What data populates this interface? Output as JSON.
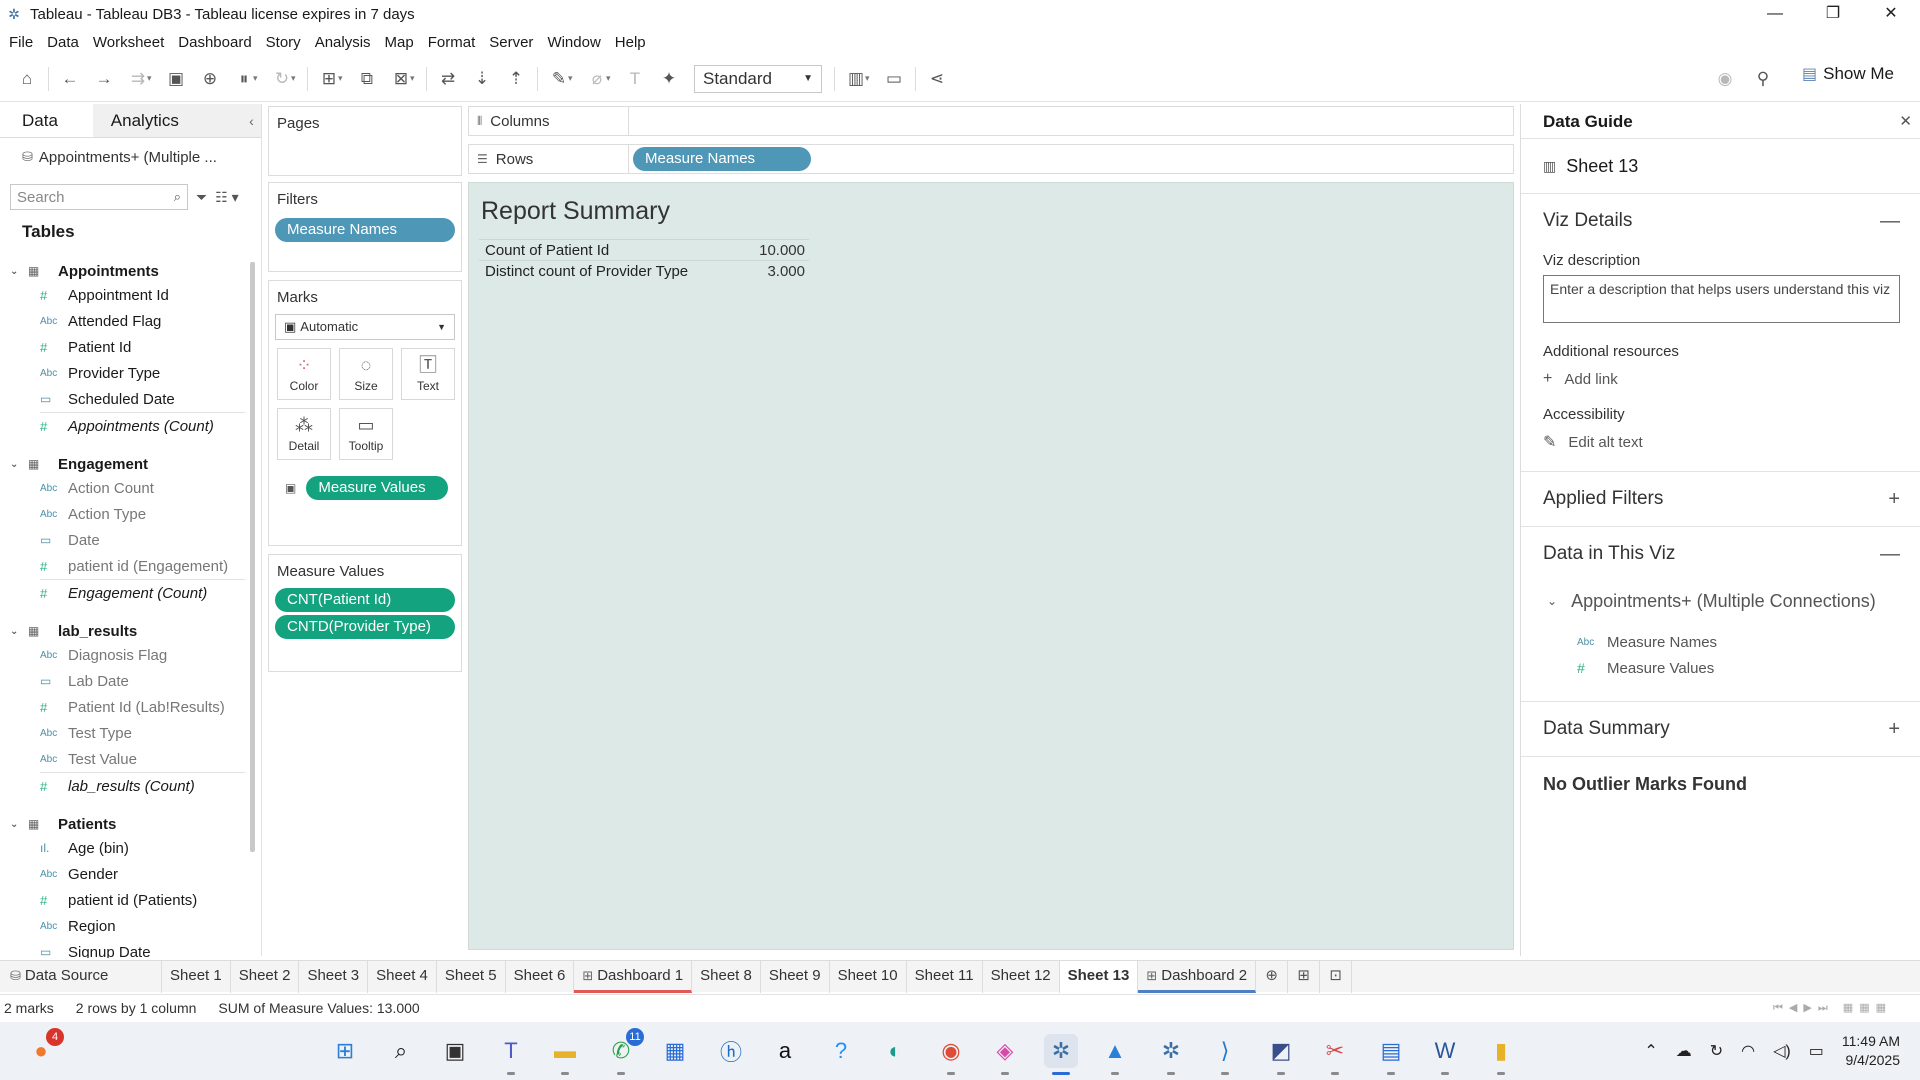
{
  "window": {
    "title": "Tableau - Tableau DB3 - Tableau license expires in 7 days",
    "controls": [
      "—",
      "❐",
      "✕"
    ]
  },
  "menu": [
    "File",
    "Data",
    "Worksheet",
    "Dashboard",
    "Story",
    "Analysis",
    "Map",
    "Format",
    "Server",
    "Window",
    "Help"
  ],
  "toolbar": {
    "fit_value": "Standard",
    "show_me": "Show Me"
  },
  "data_pane": {
    "tab_data": "Data",
    "tab_analytics": "Analytics",
    "datasource": "Appointments+ (Multiple ...",
    "search_placeholder": "Search",
    "tables_heading": "Tables",
    "groups": [
      {
        "name": "Appointments",
        "fields": [
          {
            "type": "#",
            "name": "Appointment Id"
          },
          {
            "type": "Abc",
            "name": "Attended Flag"
          },
          {
            "type": "#",
            "name": "Patient Id"
          },
          {
            "type": "Abc",
            "name": "Provider Type"
          },
          {
            "type": "date",
            "name": "Scheduled Date"
          },
          {
            "type": "#",
            "name": "Appointments (Count)"
          }
        ]
      },
      {
        "name": "Engagement",
        "fields": [
          {
            "type": "Abc",
            "name": "Action Count"
          },
          {
            "type": "Abc",
            "name": "Action Type"
          },
          {
            "type": "date",
            "name": "Date"
          },
          {
            "type": "#",
            "name": "patient id (Engagement)"
          },
          {
            "type": "#",
            "name": "Engagement (Count)"
          }
        ]
      },
      {
        "name": "lab_results",
        "fields": [
          {
            "type": "Abc",
            "name": "Diagnosis Flag"
          },
          {
            "type": "date",
            "name": "Lab Date"
          },
          {
            "type": "#",
            "name": "Patient Id (Lab!Results)"
          },
          {
            "type": "Abc",
            "name": "Test Type"
          },
          {
            "type": "Abc",
            "name": "Test Value"
          },
          {
            "type": "#",
            "name": "lab_results (Count)"
          }
        ]
      },
      {
        "name": "Patients",
        "fields": [
          {
            "type": "bin",
            "name": "Age (bin)"
          },
          {
            "type": "Abc",
            "name": "Gender"
          },
          {
            "type": "#",
            "name": "patient id (Patients)"
          },
          {
            "type": "Abc",
            "name": "Region"
          },
          {
            "type": "date",
            "name": "Signup Date"
          }
        ]
      }
    ]
  },
  "cards": {
    "pages": "Pages",
    "filters": "Filters",
    "filter_pill": "Measure Names",
    "marks": "Marks",
    "mark_type": "Automatic",
    "mark_buttons": [
      "Color",
      "Size",
      "Text",
      "Detail",
      "Tooltip"
    ],
    "marks_pill": "Measure Values",
    "measure_values_title": "Measure Values",
    "measure_values_pills": [
      "CNT(Patient Id)",
      "CNTD(Provider Type)"
    ]
  },
  "shelves": {
    "columns_label": "Columns",
    "rows_label": "Rows",
    "rows_pill": "Measure Names"
  },
  "viz": {
    "title": "Report Summary",
    "rows": [
      {
        "label": "Count of Patient Id",
        "value": "10.000"
      },
      {
        "label": "Distinct count of Provider Type",
        "value": "3.000"
      }
    ]
  },
  "guide": {
    "title": "Data Guide",
    "sheet": "Sheet 13",
    "viz_details": "Viz Details",
    "viz_description_label": "Viz description",
    "viz_description_placeholder": "Enter a description that helps users understand this viz",
    "additional_resources": "Additional resources",
    "add_link": "Add link",
    "accessibility": "Accessibility",
    "edit_alt_text": "Edit alt text",
    "applied_filters": "Applied Filters",
    "data_in_viz": "Data in This Viz",
    "data_source": "Appointments+ (Multiple Connections)",
    "fields": [
      {
        "type": "Abc",
        "name": "Measure Names"
      },
      {
        "type": "#",
        "name": "Measure Values"
      }
    ],
    "data_summary": "Data Summary",
    "no_outliers": "No Outlier Marks Found"
  },
  "sheet_tabs": {
    "data_source": "Data Source",
    "tabs": [
      "Sheet 1",
      "Sheet 2",
      "Sheet 3",
      "Sheet 4",
      "Sheet 5",
      "Sheet 6",
      "Dashboard 1",
      "Sheet 8",
      "Sheet 9",
      "Sheet 10",
      "Sheet 11",
      "Sheet 12",
      "Sheet 13",
      "Dashboard 2"
    ]
  },
  "status": {
    "marks": "2 marks",
    "dims": "2 rows by 1 column",
    "sum": "SUM of Measure Values: 13.000"
  },
  "taskbar": {
    "notif_badge": "4",
    "whatsapp_badge": "11",
    "time": "11:49 AM",
    "date": "9/4/2025"
  }
}
